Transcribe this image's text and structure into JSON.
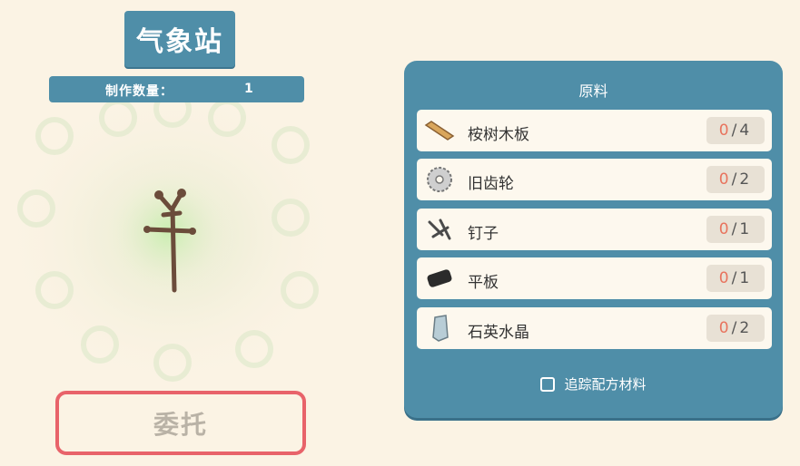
{
  "recipe": {
    "title": "气象站",
    "quantity_label": "制作数量：",
    "quantity_value": "1"
  },
  "commission_button": {
    "label": "委托"
  },
  "materials": {
    "title": "原料",
    "items": [
      {
        "icon": "eucalyptus-plank-icon",
        "name": "桉树木板",
        "have": "0",
        "need": "4"
      },
      {
        "icon": "old-gear-icon",
        "name": "旧齿轮",
        "have": "0",
        "need": "2"
      },
      {
        "icon": "nails-icon",
        "name": "钉子",
        "have": "0",
        "need": "1"
      },
      {
        "icon": "tablet-icon",
        "name": "平板",
        "have": "0",
        "need": "1"
      },
      {
        "icon": "quartz-crystal-icon",
        "name": "石英水晶",
        "have": "0",
        "need": "2"
      }
    ],
    "track_label": "追踪配方材料",
    "track_checked": false
  },
  "colors": {
    "panel": "#4f8ea8",
    "background": "#fbf3e4",
    "row_background": "#fdf8ee",
    "button_border": "#e8636a",
    "have_count": "#e8735d"
  }
}
